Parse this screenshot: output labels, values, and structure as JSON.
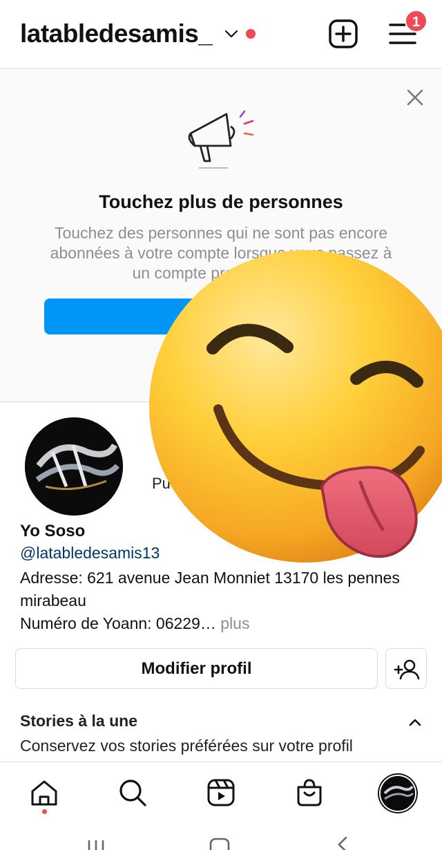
{
  "header": {
    "username": "latabledesamis_",
    "notification_count": "1"
  },
  "promo": {
    "title": "Touchez plus de personnes",
    "text": "Touchez des personnes qui ne sont pas encore abonnées à votre compte lorsque vous passez à un compte professionnel."
  },
  "profile": {
    "stat_label": "Pu",
    "name": "Yo Soso",
    "handle": "@latabledesamis13",
    "bio_line1": "Adresse: 621 avenue Jean Monniet 13170 les pennes mirabeau",
    "bio_line2": "Numéro de Yoann: 06229…",
    "more_label": " plus",
    "edit_button": "Modifier profil"
  },
  "stories": {
    "title": "Stories à la une",
    "subtitle": "Conservez vos stories préférées sur votre profil"
  },
  "colors": {
    "accent_blue": "#0095f6",
    "notification_red": "#ed4956",
    "link_blue": "#00376b",
    "muted_gray": "#8e8e8e"
  },
  "icons": {
    "header": [
      "chevron-down-icon",
      "new-post-icon",
      "menu-icon"
    ],
    "nav": [
      "home-icon",
      "search-icon",
      "reels-icon",
      "shop-icon",
      "profile-avatar"
    ],
    "system": [
      "recent-apps-icon",
      "home-button-icon",
      "back-icon"
    ]
  }
}
